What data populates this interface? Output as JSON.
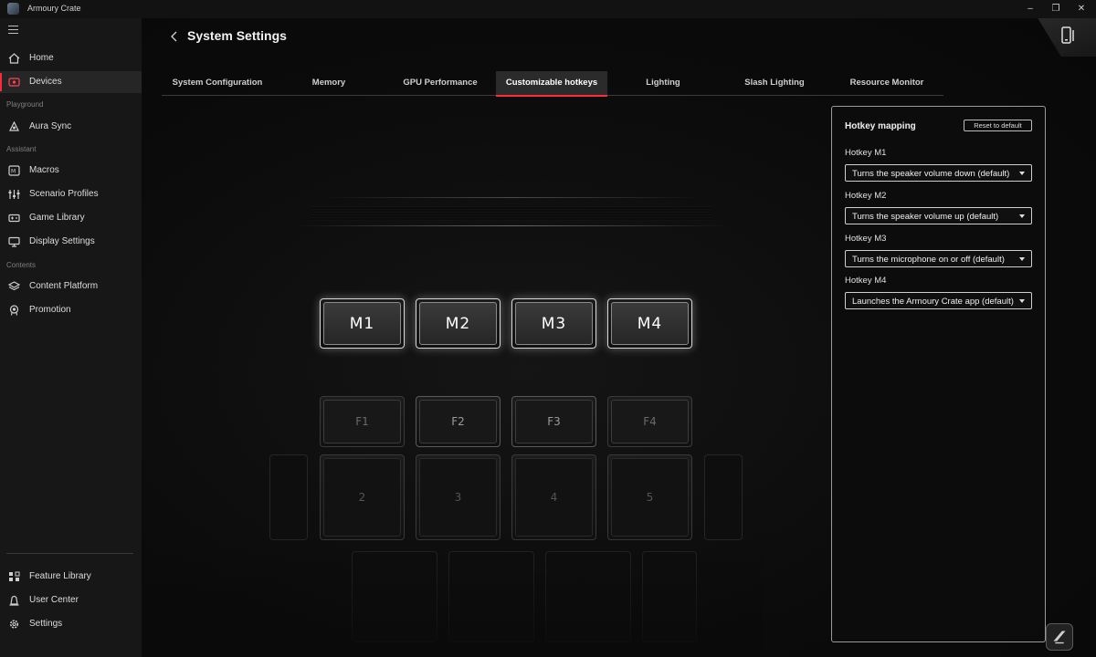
{
  "window": {
    "title": "Armoury Crate",
    "controls": [
      "minimize-icon",
      "restore-icon",
      "close-icon"
    ]
  },
  "sidebar": {
    "items": [
      {
        "label": "Home",
        "icon": "home-icon"
      },
      {
        "label": "Devices",
        "icon": "devices-icon",
        "active": true
      },
      {
        "label": "Aura Sync",
        "icon": "aura-sync-icon"
      },
      {
        "label": "Macros",
        "icon": "macros-icon"
      },
      {
        "label": "Scenario Profiles",
        "icon": "scenario-profiles-icon"
      },
      {
        "label": "Game Library",
        "icon": "game-library-icon"
      },
      {
        "label": "Display Settings",
        "icon": "display-settings-icon"
      },
      {
        "label": "Content Platform",
        "icon": "content-platform-icon"
      },
      {
        "label": "Promotion",
        "icon": "promotion-icon"
      },
      {
        "label": "Feature Library",
        "icon": "feature-library-icon"
      },
      {
        "label": "User Center",
        "icon": "user-center-icon"
      },
      {
        "label": "Settings",
        "icon": "gear-icon"
      }
    ],
    "sections": [
      "Playground",
      "Assistant",
      "Contents"
    ]
  },
  "header": {
    "title": "System Settings"
  },
  "tabs": [
    {
      "label": "System Configuration"
    },
    {
      "label": "Memory"
    },
    {
      "label": "GPU Performance"
    },
    {
      "label": "Customizable hotkeys",
      "active": true
    },
    {
      "label": "Lighting"
    },
    {
      "label": "Slash Lighting"
    },
    {
      "label": "Resource Monitor"
    }
  ],
  "keyboard": {
    "mkeys": [
      "M1",
      "M2",
      "M3",
      "M4"
    ],
    "fkeys": [
      "F1",
      "F2",
      "F3",
      "F4"
    ],
    "numkeys": [
      "2",
      "3",
      "4",
      "5"
    ]
  },
  "hotkey_panel": {
    "title": "Hotkey mapping",
    "reset_label": "Reset to default",
    "hotkeys": [
      {
        "label": "Hotkey M1",
        "value": "Turns the speaker volume down (default)"
      },
      {
        "label": "Hotkey M2",
        "value": "Turns the speaker volume up (default)"
      },
      {
        "label": "Hotkey M3",
        "value": "Turns the microphone on or off (default)"
      },
      {
        "label": "Hotkey M4",
        "value": "Launches the Armoury Crate app (default)"
      }
    ]
  },
  "colors": {
    "accent": "#ff2a3a",
    "background": "#0a0a0a",
    "sidebar": "#171717"
  }
}
